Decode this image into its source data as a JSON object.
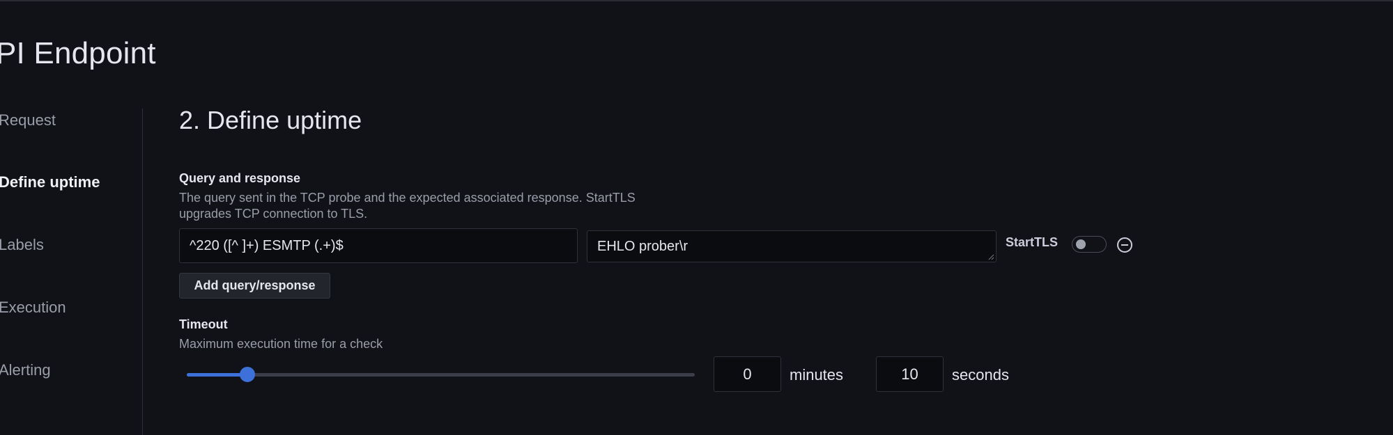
{
  "page": {
    "title": "PI Endpoint"
  },
  "steps": [
    {
      "label": "Request",
      "active": false
    },
    {
      "label": "Define uptime",
      "active": true
    },
    {
      "label": "Labels",
      "active": false
    },
    {
      "label": "Execution",
      "active": false
    },
    {
      "label": "Alerting",
      "active": false
    }
  ],
  "section": {
    "title": "2. Define uptime"
  },
  "query_response": {
    "label": "Query and response",
    "description_line1": "The query sent in the TCP probe and the expected associated response. StartTLS",
    "description_line2": "upgrades TCP connection to TLS.",
    "expected_response": "^220 ([^ ]+) ESMTP (.+)$",
    "query": "EHLO prober\\r",
    "starttls_label": "StartTLS",
    "starttls_enabled": false,
    "add_button": "Add query/response"
  },
  "timeout": {
    "label": "Timeout",
    "description": "Maximum execution time for a check",
    "slider_fraction": 0.12,
    "minutes_value": "0",
    "minutes_label": "minutes",
    "seconds_value": "10",
    "seconds_label": "seconds"
  },
  "colors": {
    "background": "#111217",
    "accent": "#3d71d9",
    "text_primary": "#e6e7ee",
    "text_secondary": "#9a9daa"
  },
  "icons": {
    "remove": "minus-circle-icon",
    "resize": "resize-handle-icon"
  }
}
